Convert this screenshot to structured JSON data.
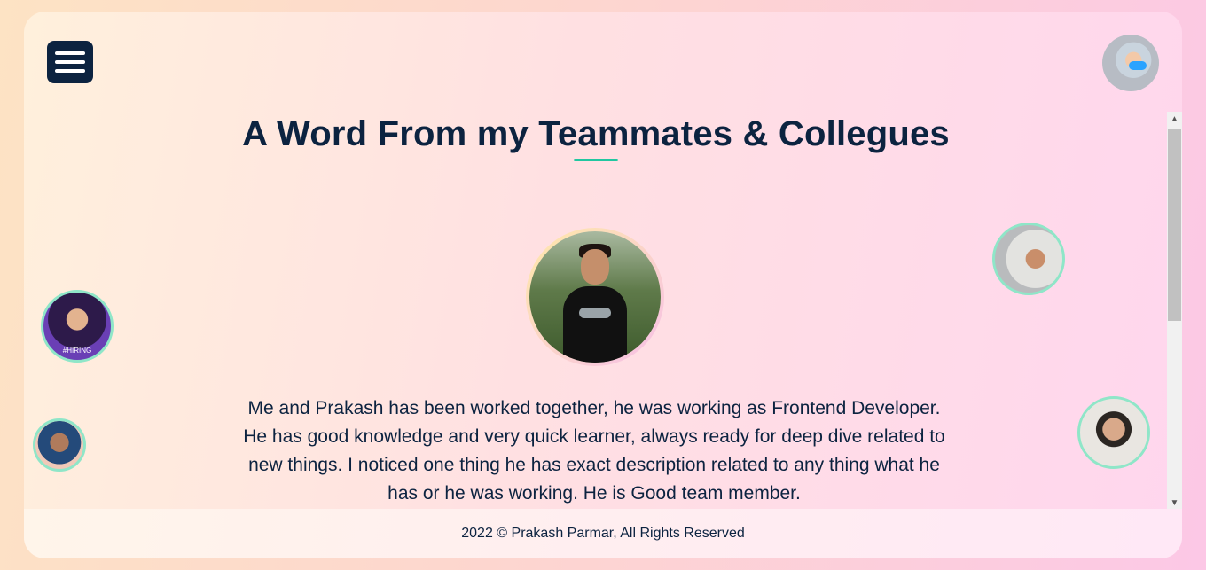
{
  "header": {
    "menu_icon": "hamburger-menu-icon",
    "profile_avatar": "profile-avatar"
  },
  "testimonials": {
    "title": "A Word From my Teammates & Collegues",
    "active": {
      "quote": "Me and Prakash has been worked together, he was working as Frontend Developer. He has good knowledge and very quick learner, always ready for deep dive related to new things. I noticed one thing he has exact description related to any thing what he has or he was working. He is Good team member."
    },
    "side_avatars": [
      {
        "badge": "#HIRING"
      }
    ],
    "accent_color": "#21c7a0",
    "text_color": "#0c2340"
  },
  "scrollbar": {
    "up_arrow": "▲",
    "down_arrow": "▼"
  },
  "footer": {
    "text": "2022 © Prakash Parmar, All Rights Reserved"
  }
}
